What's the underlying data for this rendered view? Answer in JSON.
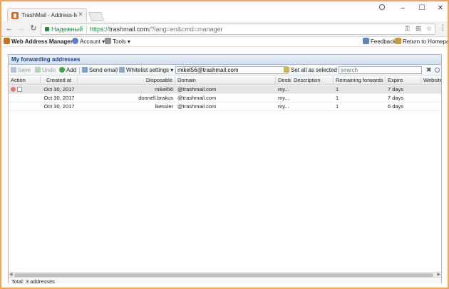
{
  "browser": {
    "tab_title": "TrashMail - Address-Ma",
    "tab_close": "×",
    "secure_label": "Надежный",
    "url_https": "https://",
    "url_host": "trashmail.com",
    "url_path": "/?lang=en&cmd=manager",
    "window_controls": {
      "minimize": "–",
      "maximize": "☐",
      "close": "✕"
    },
    "icons": [
      "back-arrow-icon",
      "forward-arrow-icon",
      "reload-icon",
      "lock-icon",
      "key-icon",
      "translate-icon",
      "star-icon",
      "menu-icon",
      "profile-icon"
    ]
  },
  "appbar": {
    "web_address_manager": "Web Address Manager ▾",
    "account": "Account ▾",
    "tools": "Tools ▾",
    "feedback": "Feedback",
    "return_home": "Return to Homepage"
  },
  "panel": {
    "title": "My forwarding addresses",
    "toolbar": {
      "save": "Save",
      "undo": "Undo",
      "add": "Add",
      "send_email": "Send email",
      "whitelist_settings": "Whitelist settings ▾",
      "email_value": "mikel56@trashmail.com",
      "set_all_selected": "Set all as selected",
      "search_placeholder": "search"
    },
    "columns": {
      "action": "Action",
      "created_at": "Created at",
      "disposable": "Disposable",
      "domain": "Domain",
      "destination": "Destina",
      "description": "Description",
      "remaining_forwards": "Remaining forwards",
      "expire": "Expire",
      "website": "Website"
    },
    "rows": [
      {
        "created_at": "Oct 30, 2017",
        "disposable": "mikel56",
        "domain": "@trashmail.com",
        "destination": "my...",
        "description": "",
        "remaining_forwards": "1",
        "expire": "7 days",
        "website": ""
      },
      {
        "created_at": "Oct 30, 2017",
        "disposable": "donnell.brakus",
        "domain": "@trashmail.com",
        "destination": "my...",
        "description": "",
        "remaining_forwards": "1",
        "expire": "7 days",
        "website": ""
      },
      {
        "created_at": "Oct 30, 2017",
        "disposable": "lkessler",
        "domain": "@trashmail.com",
        "destination": "my...",
        "description": "",
        "remaining_forwards": "1",
        "expire": "6 days",
        "website": ""
      }
    ],
    "status": "Total: 3 addresses"
  },
  "colors": {
    "window_border": "#e9a356",
    "secure_green": "#1e8e3e",
    "panel_title": "#15428b",
    "selected_row": "#e4e4e4"
  }
}
